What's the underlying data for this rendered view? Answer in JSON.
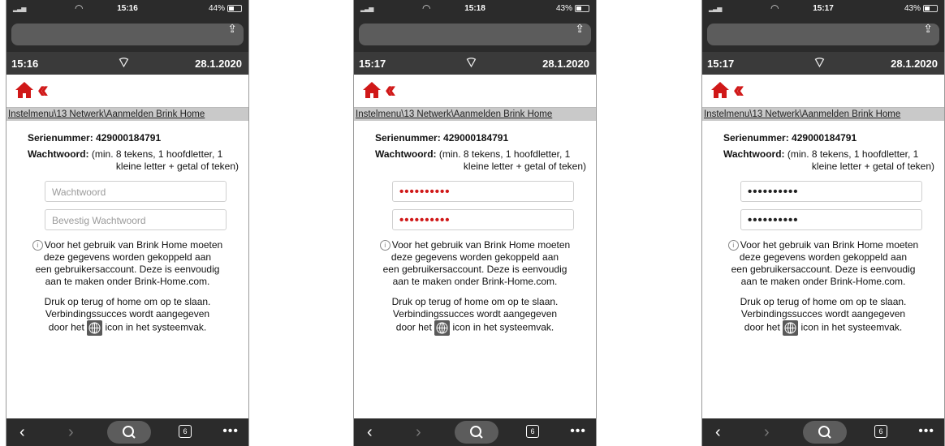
{
  "screens": [
    {
      "ios_time": "15:16",
      "ios_battery": "44%",
      "device_time": "15:16",
      "device_date": "28.1.2020",
      "breadcrumb": "Instelmenu\\13 Netwerk\\Aanmelden Brink Home",
      "serial_label": "Serienummer:",
      "serial_value": "429000184791",
      "password_label": "Wachtwoord:",
      "password_hint_1": "(min. 8 tekens, 1 hoofdletter, 1",
      "password_hint_2": "kleine letter + getal of teken)",
      "password_field": "Wachtwoord",
      "confirm_field": "Bevestig Wachtwoord",
      "info_text_1": "Voor het gebruik van Brink Home moeten",
      "info_text_2": "deze gegevens worden gekoppeld aan",
      "info_text_3": "een gebruikersaccount. Deze is eenvoudig",
      "info_text_4": "aan te maken onder Brink-Home.com.",
      "note_1": "Druk op terug of home om op te slaan.",
      "note_2": "Verbindingssucces wordt aangegeven",
      "note_3a": "door het",
      "note_3b": "icon in het systeemvak.",
      "tabs_count": "6"
    },
    {
      "ios_time": "15:18",
      "ios_battery": "43%",
      "device_time": "15:17",
      "device_date": "28.1.2020",
      "breadcrumb": "Instelmenu\\13 Netwerk\\Aanmelden Brink Home",
      "serial_label": "Serienummer:",
      "serial_value": "429000184791",
      "password_label": "Wachtwoord:",
      "password_hint_1": "(min. 8 tekens, 1 hoofdletter, 1",
      "password_hint_2": "kleine letter + getal of teken)",
      "password_field": "••••••••••",
      "confirm_field": "••••••••••",
      "info_text_1": "Voor het gebruik van Brink Home moeten",
      "info_text_2": "deze gegevens worden gekoppeld aan",
      "info_text_3": "een gebruikersaccount. Deze is eenvoudig",
      "info_text_4": "aan te maken onder Brink-Home.com.",
      "note_1": "Druk op terug of home om op te slaan.",
      "note_2": "Verbindingssucces wordt aangegeven",
      "note_3a": "door het",
      "note_3b": "icon in het systeemvak.",
      "tabs_count": "6"
    },
    {
      "ios_time": "15:17",
      "ios_battery": "43%",
      "device_time": "15:17",
      "device_date": "28.1.2020",
      "breadcrumb": "Instelmenu\\13 Netwerk\\Aanmelden Brink Home",
      "serial_label": "Serienummer:",
      "serial_value": "429000184791",
      "password_label": "Wachtwoord:",
      "password_hint_1": "(min. 8 tekens, 1 hoofdletter, 1",
      "password_hint_2": "kleine letter + getal of teken)",
      "password_field": "••••••••••",
      "confirm_field": "••••••••••",
      "info_text_1": "Voor het gebruik van Brink Home moeten",
      "info_text_2": "deze gegevens worden gekoppeld aan",
      "info_text_3": "een gebruikersaccount. Deze is eenvoudig",
      "info_text_4": "aan te maken onder Brink-Home.com.",
      "note_1": "Druk op terug of home om op te slaan.",
      "note_2": "Verbindingssucces wordt aangegeven",
      "note_3a": "door het",
      "note_3b": "icon in het systeemvak.",
      "tabs_count": "6"
    }
  ],
  "colors": {
    "accent_red": "#d01818",
    "status_bar": "#2b2b2b",
    "breadcrumb_bg": "#c9c9c9"
  },
  "icons": [
    "home-icon",
    "double-chevron-left-icon",
    "wifi-icon",
    "info-icon",
    "globe-icon",
    "search-icon",
    "share-icon"
  ]
}
